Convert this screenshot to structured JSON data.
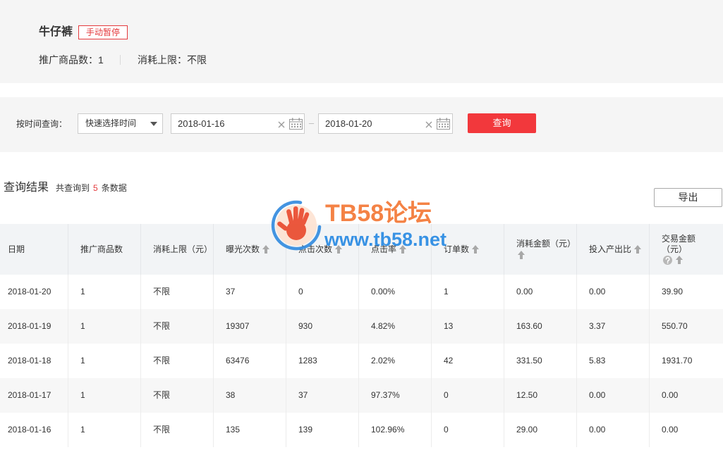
{
  "plan": {
    "title": "牛仔裤",
    "status": "手动暂停",
    "promoted_count_label": "推广商品数：",
    "promoted_count": "1",
    "spend_limit_label": "消耗上限：",
    "spend_limit": "不限"
  },
  "filter": {
    "label": "按时间查询：",
    "quick_select_value": "快速选择时间",
    "start_date": "2018-01-16",
    "range_separator": "–",
    "end_date": "2018-01-20",
    "query_button": "查询"
  },
  "results": {
    "title": "查询结果",
    "count_prefix": "共查询到",
    "count": "5",
    "count_suffix": "条数据",
    "export_button": "导出"
  },
  "table": {
    "columns": [
      {
        "label": "日期"
      },
      {
        "label": "推广商品数"
      },
      {
        "label": "消耗上限（元）"
      },
      {
        "label": "曝光次数",
        "sort_icon": "arrow-up-icon"
      },
      {
        "label": "点击次数",
        "sort_icon": "arrow-up-icon"
      },
      {
        "label": "点击率",
        "sort_icon": "arrow-up-icon"
      },
      {
        "label": "订单数",
        "sort_icon": "arrow-up-icon"
      },
      {
        "label": "消耗金额（元）",
        "sort_icon": "arrow-up-icon"
      },
      {
        "label": "投入产出比",
        "sort_icon": "arrow-up-icon"
      },
      {
        "label": "交易金额（元）",
        "help_icon": "question-circle-icon",
        "sort_icon": "arrow-up-icon"
      }
    ],
    "rows": [
      [
        "2018-01-20",
        "1",
        "不限",
        "37",
        "0",
        "0.00%",
        "1",
        "0.00",
        "0.00",
        "39.90"
      ],
      [
        "2018-01-19",
        "1",
        "不限",
        "19307",
        "930",
        "4.82%",
        "13",
        "163.60",
        "3.37",
        "550.70"
      ],
      [
        "2018-01-18",
        "1",
        "不限",
        "63476",
        "1283",
        "2.02%",
        "42",
        "331.50",
        "5.83",
        "1931.70"
      ],
      [
        "2018-01-17",
        "1",
        "不限",
        "38",
        "37",
        "97.37%",
        "0",
        "12.50",
        "0.00",
        "0.00"
      ],
      [
        "2018-01-16",
        "1",
        "不限",
        "135",
        "139",
        "102.96%",
        "0",
        "29.00",
        "0.00",
        "0.00"
      ]
    ]
  },
  "watermark": {
    "logo_icon": "hand-logo-icon",
    "title": "TB58论坛",
    "url": "www.tb58.net"
  },
  "icons": {
    "select_caret": "caret-down-icon",
    "clear": "clear-icon",
    "calendar": "calendar-icon"
  },
  "colors": {
    "status_badge": "#e4393c",
    "query_button": "#f2383c",
    "count_highlight": "#e4393c",
    "table_header_bg": "#f2f4f6",
    "watermark_title": "#f47c3c",
    "watermark_url": "#2f8de4"
  }
}
